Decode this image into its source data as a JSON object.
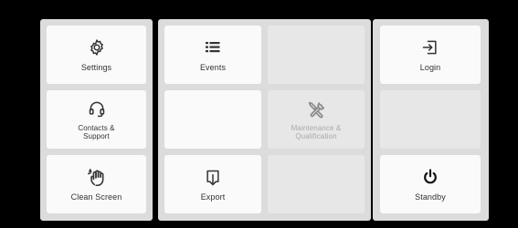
{
  "panels": {
    "left": [
      {
        "label": "Settings",
        "icon": "gear-icon"
      },
      {
        "label": "Contacts &\nSupport",
        "icon": "headset-icon"
      },
      {
        "label": "Clean Screen",
        "icon": "hand-touch-icon"
      }
    ],
    "middle": [
      {
        "label": "Events",
        "icon": "list-icon"
      },
      {
        "label": "",
        "icon": ""
      },
      {
        "label": "",
        "icon": ""
      },
      {
        "label": "Maintenance &\nQualification",
        "icon": "tools-icon",
        "disabled": true
      },
      {
        "label": "Export",
        "icon": "export-icon"
      },
      {
        "label": "",
        "icon": ""
      }
    ],
    "right": [
      {
        "label": "Login",
        "icon": "login-icon"
      },
      {
        "label": "",
        "icon": ""
      },
      {
        "label": "Standby",
        "icon": "power-icon"
      }
    ]
  },
  "colors": {
    "background": "#000000",
    "panel": "#dcdcdc",
    "tile": "#fafafa",
    "tile_empty": "#e7e7e7",
    "text": "#333333",
    "text_disabled": "#a9a9a9"
  }
}
